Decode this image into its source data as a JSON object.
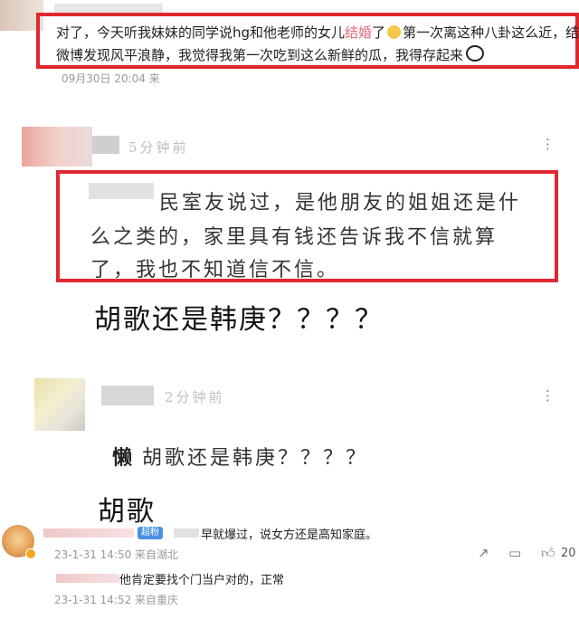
{
  "comment1": {
    "line1": "对了，今天听我妹妹的同学说hg和他老师的女儿",
    "highlight": "结婚",
    "line1_tail": "了",
    "emoji_tail": "第一次离这种八卦这么近，结果上",
    "line2": "微博发现风平浪静，我觉得我第一次吃到这么新鲜的瓜，我得存起来",
    "timestamp": "09月30日 20:04 来"
  },
  "comment2": {
    "time": "5分钟前",
    "quote_line1": "室友说过，是他朋友的姐姐还是什",
    "quote_line1_prefix": "民",
    "quote_line2": "么之类的，家里具有钱还告诉我不信就算",
    "quote_line3": "了，我也不知道信不信。",
    "reply": "胡歌还是韩庚？？？？"
  },
  "comment3": {
    "time": "2分钟前",
    "quote_prefix": "懒",
    "quote": "胡歌还是韩庚？？？？",
    "reply": "胡歌"
  },
  "comment4": {
    "badge": "超粉",
    "text": "早就爆过，说女方还是高知家庭。",
    "date1": "23-1-31 14:50 来自湖北",
    "reply_text": "他肯定要找个门当户对的，正常",
    "date2": "23-1-31 14:52 来自重庆",
    "like_count": "20"
  },
  "icons": {
    "more": "more-icon",
    "share": "share-icon",
    "comment": "comment-icon",
    "like": "like-icon"
  },
  "colors": {
    "highlight_box": "#e0282f",
    "link": "#1e90ff"
  }
}
